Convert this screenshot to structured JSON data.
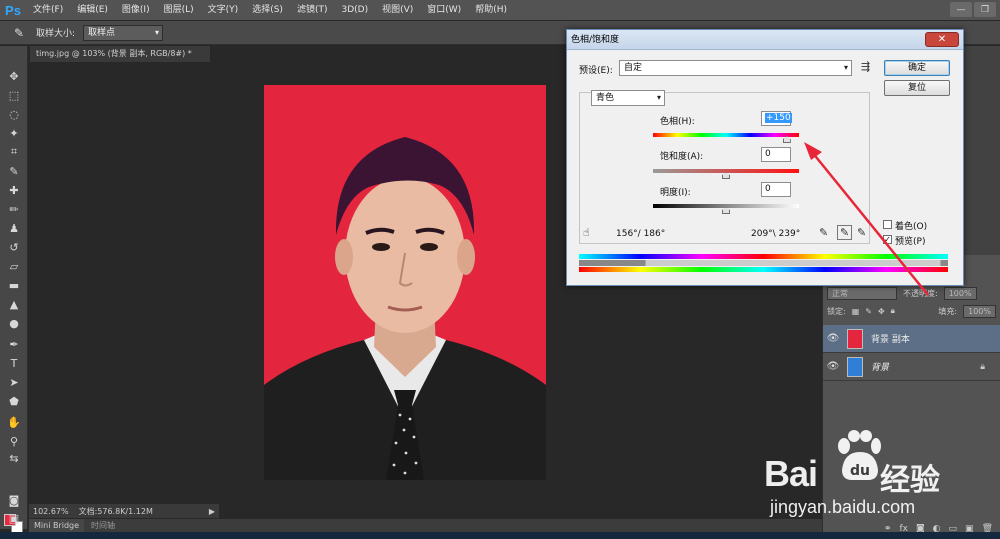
{
  "app": {
    "logo": "Ps"
  },
  "menu": [
    "文件(F)",
    "编辑(E)",
    "图像(I)",
    "图层(L)",
    "文字(Y)",
    "选择(S)",
    "滤镜(T)",
    "3D(D)",
    "视图(V)",
    "窗口(W)",
    "帮助(H)"
  ],
  "window_controls": {
    "minimize": "—",
    "restore": "❐"
  },
  "options": {
    "size_label": "取样大小:",
    "size_value": "取样点"
  },
  "document": {
    "tab_title": "timg.jpg @ 103% (背景 副本, RGB/8#) *",
    "zoom": "102.67%",
    "doc_size": "文档:576.8K/1.12M"
  },
  "bottom_tabs": [
    "Mini Bridge",
    "时间轴"
  ],
  "layers_panel": {
    "opacity_label": "不透明度:",
    "opacity_value": "100%",
    "lock_label": "锁定:",
    "fill_label": "填充:",
    "fill_value": "100%",
    "blend_mode": "正常",
    "layers": [
      {
        "name": "背景 副本",
        "selected": true
      },
      {
        "name": "背景",
        "selected": false,
        "locked": true
      }
    ],
    "footer_fx": "fx"
  },
  "dialog": {
    "title": "色相/饱和度",
    "close": "✕",
    "preset_label": "预设(E):",
    "preset_value": "自定",
    "ok": "确定",
    "reset": "复位",
    "channel": "青色",
    "hue_label": "色相(H):",
    "hue_value": "+150",
    "hue_level": 150,
    "sat_label": "饱和度(A):",
    "sat_value": "0",
    "light_label": "明度(I):",
    "light_value": "0",
    "range_left": "156°/ 186°",
    "range_right": "209°\\ 239°",
    "colorize_label": "着色(O)",
    "colorize_checked": false,
    "preview_label": "预览(P)",
    "preview_checked": true
  },
  "watermark": {
    "brand": "Bai",
    "brand_suffix": "经验",
    "url": "jingyan.baidu.com"
  },
  "colors": {
    "photo_background": "#e4253e",
    "selected_layer": "#5d6f86",
    "arrow": "#e8263a"
  }
}
